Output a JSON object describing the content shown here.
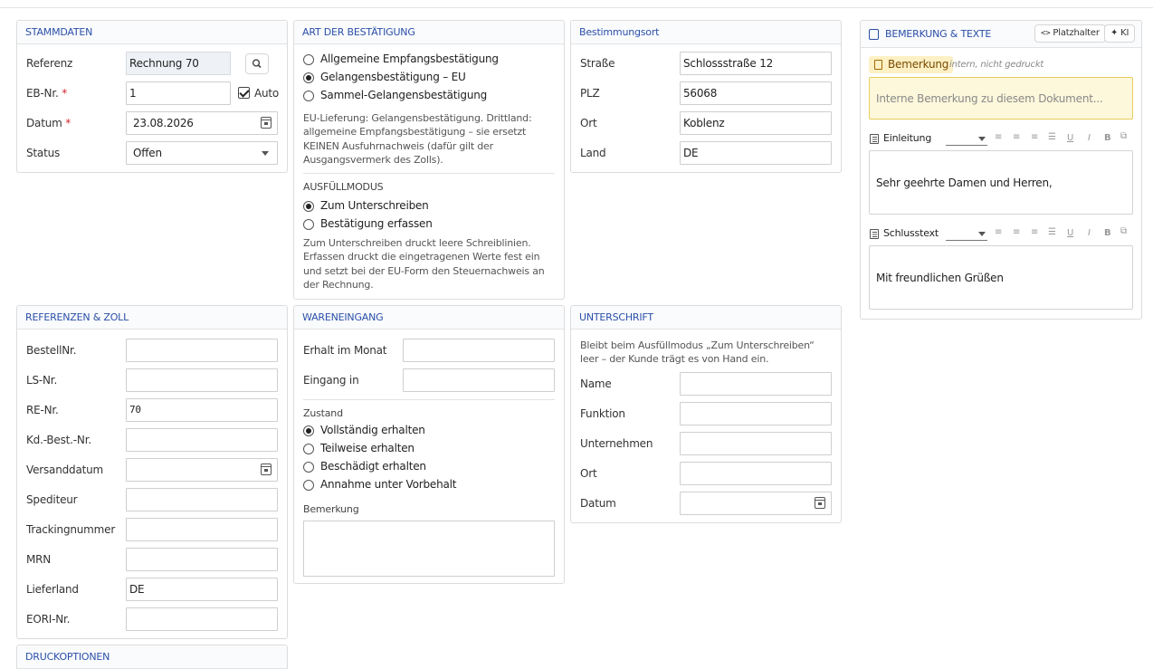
{
  "stammdaten": {
    "title": "STAMMDATEN",
    "referenz_label": "Referenz",
    "referenz_value": "Rechnung 70",
    "ebnr_label": "EB-Nr.",
    "ebnr_value": "1",
    "auto_label": "Auto",
    "auto_checked": true,
    "datum_label": "Datum",
    "datum_value": "23.08.2026",
    "status_label": "Status",
    "status_value": "Offen",
    "required_mark": "*"
  },
  "art": {
    "title": "ART DER BESTÄTIGUNG",
    "options": [
      {
        "label": "Allgemeine Empfangsbestätigung",
        "selected": false
      },
      {
        "label": "Gelangensbestätigung – EU",
        "selected": true
      },
      {
        "label": "Sammel-Gelangensbestätigung",
        "selected": false
      }
    ],
    "help": "EU-Lieferung: Gelangensbestätigung. Drittland: allgemeine Empfangsbestätigung – sie ersetzt KEINEN Ausfuhrnachweis (dafür gilt der Ausgangsvermerk des Zolls).",
    "mode_title": "AUSFÜLLMODUS",
    "modes": [
      {
        "label": "Zum Unterschreiben",
        "selected": true
      },
      {
        "label": "Bestätigung erfassen",
        "selected": false
      }
    ],
    "mode_help": "Zum Unterschreiben druckt leere Schreiblinien. Erfassen druckt die eingetragenen Werte fest ein und setzt bei der EU-Form den Steuernachweis an der Rechnung."
  },
  "bestimmungsort": {
    "title": "Bestimmungsort",
    "strasse_label": "Straße",
    "strasse_value": "Schlossstraße 12",
    "plz_label": "PLZ",
    "plz_value": "56068",
    "ort_label": "Ort",
    "ort_value": "Koblenz",
    "land_label": "Land",
    "land_value": "DE"
  },
  "bemerkung": {
    "title": "BEMERKUNG & TEXTE",
    "platzhalter_label": "Platzhalter",
    "ki_label": "KI",
    "tag_label": "Bemerkung",
    "tag_hint": "intern, nicht gedruckt",
    "memo_placeholder": "Interne Bemerkung zu diesem Dokument...",
    "einleitung_label": "Einleitung",
    "einleitung_text": "Sehr geehrte Damen und Herren,",
    "schluss_label": "Schlusstext",
    "schluss_text": "Mit freundlichen Grüßen",
    "fmt_u": "U",
    "fmt_i": "I",
    "fmt_b": "B"
  },
  "referenzen": {
    "title": "REFERENZEN & ZOLL",
    "fields": [
      {
        "label": "BestellNr.",
        "value": ""
      },
      {
        "label": "LS-Nr.",
        "value": ""
      },
      {
        "label": "RE-Nr.",
        "value": "70"
      },
      {
        "label": "Kd.-Best.-Nr.",
        "value": ""
      },
      {
        "label": "Versanddatum",
        "value": ""
      },
      {
        "label": "Spediteur",
        "value": ""
      },
      {
        "label": "Trackingnummer",
        "value": ""
      },
      {
        "label": "MRN",
        "value": ""
      },
      {
        "label": "Lieferland",
        "value": "DE"
      },
      {
        "label": "EORI-Nr.",
        "value": ""
      }
    ]
  },
  "wareneingang": {
    "title": "WARENEINGANG",
    "monat_label": "Erhalt im Monat",
    "eingang_label": "Eingang in",
    "zustand_title": "Zustand",
    "zustand": [
      {
        "label": "Vollständig erhalten",
        "selected": true
      },
      {
        "label": "Teilweise erhalten",
        "selected": false
      },
      {
        "label": "Beschädigt erhalten",
        "selected": false
      },
      {
        "label": "Annahme unter Vorbehalt",
        "selected": false
      }
    ],
    "bemerkung_label": "Bemerkung"
  },
  "unterschrift": {
    "title": "UNTERSCHRIFT",
    "help": "Bleibt beim Ausfüllmodus „Zum Unterschreiben“ leer – der Kunde trägt es von Hand ein.",
    "name_label": "Name",
    "funktion_label": "Funktion",
    "unternehmen_label": "Unternehmen",
    "ort_label": "Ort",
    "datum_label": "Datum"
  },
  "druckoptionen": {
    "title": "DRUCKOPTIONEN"
  }
}
